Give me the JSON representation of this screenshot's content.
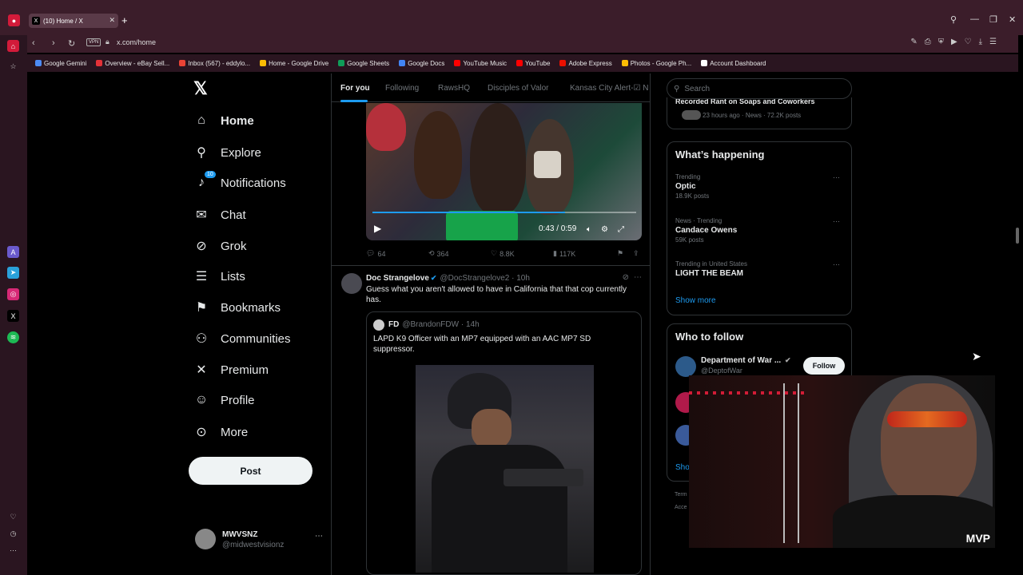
{
  "browser": {
    "tab_title": "(10) Home / X",
    "url": "x.com/home",
    "vpn_label": "VPN",
    "bookmarks": [
      {
        "label": "Google Gemini",
        "color": "#4c8bf5"
      },
      {
        "label": "Overview - eBay Sell...",
        "color": "#e53238"
      },
      {
        "label": "Inbox (567) - eddylo...",
        "color": "#ea4335"
      },
      {
        "label": "Home - Google Drive",
        "color": "#fbbc04"
      },
      {
        "label": "Google Sheets",
        "color": "#0f9d58"
      },
      {
        "label": "Google Docs",
        "color": "#4285f4"
      },
      {
        "label": "YouTube Music",
        "color": "#ff0000"
      },
      {
        "label": "YouTube",
        "color": "#ff0000"
      },
      {
        "label": "Adobe Express",
        "color": "#eb1000"
      },
      {
        "label": "Photos - Google Ph...",
        "color": "#fbbc04"
      },
      {
        "label": "Account Dashboard",
        "color": "#ffffff"
      }
    ]
  },
  "nav": {
    "items": [
      {
        "label": "Home",
        "icon": "home-icon",
        "glyph": "⌂"
      },
      {
        "label": "Explore",
        "icon": "search-icon",
        "glyph": "⚲"
      },
      {
        "label": "Notifications",
        "icon": "bell-icon",
        "glyph": "♪"
      },
      {
        "label": "Chat",
        "icon": "mail-icon",
        "glyph": "✉"
      },
      {
        "label": "Grok",
        "icon": "grok-icon",
        "glyph": "⊘"
      },
      {
        "label": "Lists",
        "icon": "list-icon",
        "glyph": "☰"
      },
      {
        "label": "Bookmarks",
        "icon": "bookmark-icon",
        "glyph": "⚑"
      },
      {
        "label": "Communities",
        "icon": "communities-icon",
        "glyph": "⚇"
      },
      {
        "label": "Premium",
        "icon": "x-premium-icon",
        "glyph": "✕"
      },
      {
        "label": "Profile",
        "icon": "profile-icon",
        "glyph": "☺"
      },
      {
        "label": "More",
        "icon": "more-circle-icon",
        "glyph": "⊙"
      }
    ],
    "notification_badge": "10",
    "post_label": "Post",
    "account_name": "MWVSNZ",
    "account_handle": "@midwestvisionz"
  },
  "feed": {
    "tabs": [
      "For you",
      "Following",
      "RawsHQ",
      "Disciples of Valor",
      "Kansas City Alert-☑ N"
    ],
    "video": {
      "time": "0:43 / 0:59",
      "progress": 0.73
    },
    "actions": {
      "replies": "64",
      "reposts": "364",
      "likes": "8.8K",
      "views": "117K"
    },
    "tweet": {
      "name": "Doc Strangelove",
      "handle": "@DocStrangelove2 · 10h",
      "text": "Guess what you aren't allowed to have in California that that cop currently has."
    },
    "quote": {
      "name": "FD",
      "handle": "@BrandonFDW · 14h",
      "text": "LAPD K9 Officer with an MP7 equipped with an AAC MP7 SD suppressor."
    }
  },
  "right": {
    "search_placeholder": "Search",
    "news_top": {
      "title": "Recorded Rant on Soaps and Coworkers",
      "meta": "23 hours ago · News · 72.2K posts"
    },
    "happening_title": "What’s happening",
    "trends": [
      {
        "category": "Trending",
        "name": "Optic",
        "count": "18.9K posts"
      },
      {
        "category": "News · Trending",
        "name": "Candace Owens",
        "count": "59K posts"
      },
      {
        "category": "Trending in United States",
        "name": "LIGHT THE BEAM",
        "count": ""
      }
    ],
    "show_more": "Show more",
    "wtf_title": "Who to follow",
    "wtf": {
      "name": "Department of War ...",
      "handle": "@DeptofWar",
      "follow": "Follow"
    },
    "wtf_show": "Show",
    "footer_terms": "Term",
    "footer_acc": "Acce"
  },
  "overlay": {
    "brand": "MVP"
  }
}
